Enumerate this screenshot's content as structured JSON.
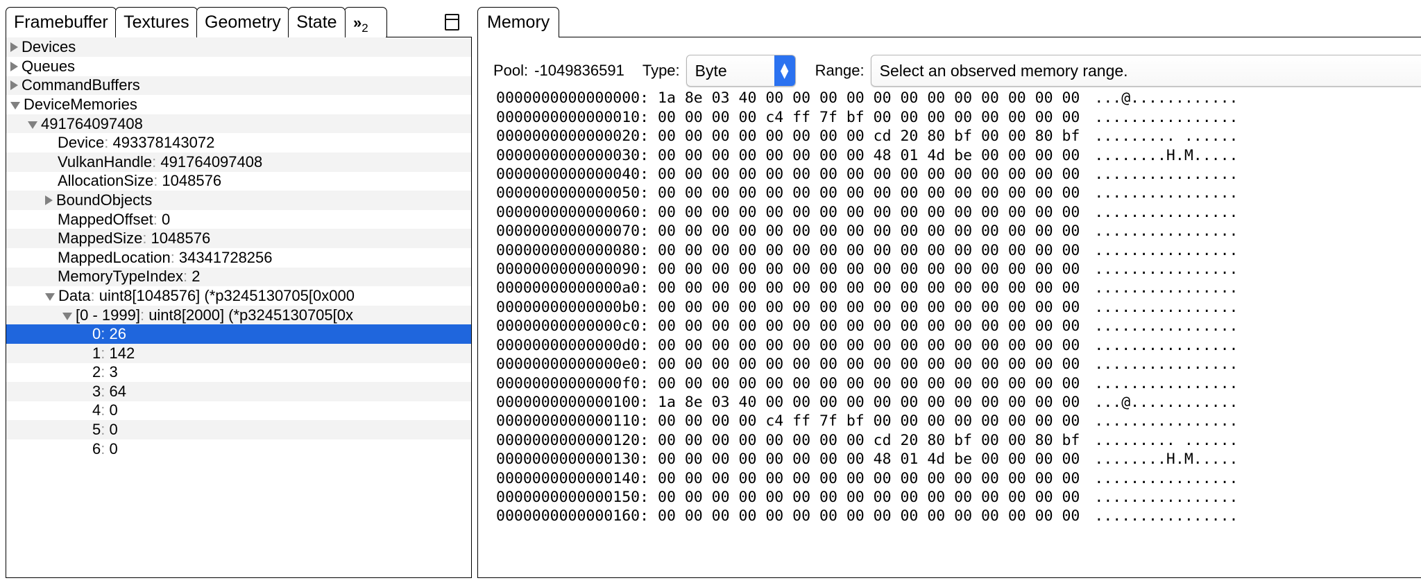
{
  "left_panel": {
    "tabs": [
      {
        "label": "Framebuffer",
        "active": false
      },
      {
        "label": "Textures",
        "active": false
      },
      {
        "label": "Geometry",
        "active": false
      },
      {
        "label": "State",
        "active": true
      }
    ],
    "overflow_tab": {
      "chevron": "»",
      "count": "2"
    },
    "dock_icon": "panel-dock-icon",
    "tree": [
      {
        "indent": 0,
        "arrow": "closed",
        "label": "Devices",
        "colon": "",
        "value": ""
      },
      {
        "indent": 0,
        "arrow": "closed",
        "label": "Queues",
        "colon": "",
        "value": ""
      },
      {
        "indent": 0,
        "arrow": "closed",
        "label": "CommandBuffers",
        "colon": "",
        "value": ""
      },
      {
        "indent": 0,
        "arrow": "open",
        "label": "DeviceMemories",
        "colon": "",
        "value": ""
      },
      {
        "indent": 1,
        "arrow": "open",
        "label": "491764097408",
        "colon": "",
        "value": ""
      },
      {
        "indent": 2,
        "arrow": "none",
        "label": "Device",
        "colon": ":",
        "value": "493378143072"
      },
      {
        "indent": 2,
        "arrow": "none",
        "label": "VulkanHandle",
        "colon": ":",
        "value": "491764097408"
      },
      {
        "indent": 2,
        "arrow": "none",
        "label": "AllocationSize",
        "colon": ":",
        "value": "1048576"
      },
      {
        "indent": 2,
        "arrow": "closed",
        "label": "BoundObjects",
        "colon": "",
        "value": ""
      },
      {
        "indent": 2,
        "arrow": "none",
        "label": "MappedOffset",
        "colon": ":",
        "value": "0"
      },
      {
        "indent": 2,
        "arrow": "none",
        "label": "MappedSize",
        "colon": ":",
        "value": "1048576"
      },
      {
        "indent": 2,
        "arrow": "none",
        "label": "MappedLocation",
        "colon": ":",
        "value": "34341728256"
      },
      {
        "indent": 2,
        "arrow": "none",
        "label": "MemoryTypeIndex",
        "colon": ":",
        "value": "2"
      },
      {
        "indent": 2,
        "arrow": "open",
        "label": "Data",
        "colon": ":",
        "value": "uint8[1048576] (*p3245130705[0x000"
      },
      {
        "indent": 3,
        "arrow": "open",
        "label": "[0 - 1999]",
        "colon": ":",
        "value": "uint8[2000] (*p3245130705[0x"
      },
      {
        "indent": 4,
        "arrow": "none",
        "label": "0",
        "colon": ":",
        "value": "26",
        "selected": true
      },
      {
        "indent": 4,
        "arrow": "none",
        "label": "1",
        "colon": ":",
        "value": "142"
      },
      {
        "indent": 4,
        "arrow": "none",
        "label": "2",
        "colon": ":",
        "value": "3"
      },
      {
        "indent": 4,
        "arrow": "none",
        "label": "3",
        "colon": ":",
        "value": "64"
      },
      {
        "indent": 4,
        "arrow": "none",
        "label": "4",
        "colon": ":",
        "value": "0"
      },
      {
        "indent": 4,
        "arrow": "none",
        "label": "5",
        "colon": ":",
        "value": "0"
      },
      {
        "indent": 4,
        "arrow": "none",
        "label": "6",
        "colon": ":",
        "value": "0"
      }
    ]
  },
  "right_panel": {
    "tab": {
      "label": "Memory"
    },
    "minimize_icon": "window-minimize-icon",
    "controls": {
      "pool_label": "Pool:",
      "pool_value": "-1049836591",
      "type_label": "Type:",
      "type_value": "Byte",
      "range_label": "Range:",
      "range_value": "Select an observed memory range."
    },
    "hexdump": [
      {
        "addr": "0000000000000000",
        "bytes": "1a 8e 03 40 00 00 00 00 00 00 00 00 00 00 00 00",
        "ascii": "...@............"
      },
      {
        "addr": "0000000000000010",
        "bytes": "00 00 00 00 c4 ff 7f bf 00 00 00 00 00 00 00 00",
        "ascii": "................"
      },
      {
        "addr": "0000000000000020",
        "bytes": "00 00 00 00 00 00 00 00 cd 20 80 bf 00 00 80 bf",
        "ascii": "......... ......"
      },
      {
        "addr": "0000000000000030",
        "bytes": "00 00 00 00 00 00 00 00 48 01 4d be 00 00 00 00",
        "ascii": "........H.M....."
      },
      {
        "addr": "0000000000000040",
        "bytes": "00 00 00 00 00 00 00 00 00 00 00 00 00 00 00 00",
        "ascii": "................"
      },
      {
        "addr": "0000000000000050",
        "bytes": "00 00 00 00 00 00 00 00 00 00 00 00 00 00 00 00",
        "ascii": "................"
      },
      {
        "addr": "0000000000000060",
        "bytes": "00 00 00 00 00 00 00 00 00 00 00 00 00 00 00 00",
        "ascii": "................"
      },
      {
        "addr": "0000000000000070",
        "bytes": "00 00 00 00 00 00 00 00 00 00 00 00 00 00 00 00",
        "ascii": "................"
      },
      {
        "addr": "0000000000000080",
        "bytes": "00 00 00 00 00 00 00 00 00 00 00 00 00 00 00 00",
        "ascii": "................"
      },
      {
        "addr": "0000000000000090",
        "bytes": "00 00 00 00 00 00 00 00 00 00 00 00 00 00 00 00",
        "ascii": "................"
      },
      {
        "addr": "00000000000000a0",
        "bytes": "00 00 00 00 00 00 00 00 00 00 00 00 00 00 00 00",
        "ascii": "................"
      },
      {
        "addr": "00000000000000b0",
        "bytes": "00 00 00 00 00 00 00 00 00 00 00 00 00 00 00 00",
        "ascii": "................"
      },
      {
        "addr": "00000000000000c0",
        "bytes": "00 00 00 00 00 00 00 00 00 00 00 00 00 00 00 00",
        "ascii": "................"
      },
      {
        "addr": "00000000000000d0",
        "bytes": "00 00 00 00 00 00 00 00 00 00 00 00 00 00 00 00",
        "ascii": "................"
      },
      {
        "addr": "00000000000000e0",
        "bytes": "00 00 00 00 00 00 00 00 00 00 00 00 00 00 00 00",
        "ascii": "................"
      },
      {
        "addr": "00000000000000f0",
        "bytes": "00 00 00 00 00 00 00 00 00 00 00 00 00 00 00 00",
        "ascii": "................"
      },
      {
        "addr": "0000000000000100",
        "bytes": "1a 8e 03 40 00 00 00 00 00 00 00 00 00 00 00 00",
        "ascii": "...@............"
      },
      {
        "addr": "0000000000000110",
        "bytes": "00 00 00 00 c4 ff 7f bf 00 00 00 00 00 00 00 00",
        "ascii": "................"
      },
      {
        "addr": "0000000000000120",
        "bytes": "00 00 00 00 00 00 00 00 cd 20 80 bf 00 00 80 bf",
        "ascii": "......... ......"
      },
      {
        "addr": "0000000000000130",
        "bytes": "00 00 00 00 00 00 00 00 48 01 4d be 00 00 00 00",
        "ascii": "........H.M....."
      },
      {
        "addr": "0000000000000140",
        "bytes": "00 00 00 00 00 00 00 00 00 00 00 00 00 00 00 00",
        "ascii": "................"
      },
      {
        "addr": "0000000000000150",
        "bytes": "00 00 00 00 00 00 00 00 00 00 00 00 00 00 00 00",
        "ascii": "................"
      },
      {
        "addr": "0000000000000160",
        "bytes": "00 00 00 00 00 00 00 00 00 00 00 00 00 00 00 00",
        "ascii": "................"
      }
    ]
  },
  "colors": {
    "selection": "#1f66dd",
    "combo_button": "#2b72f0",
    "row_alt": "#f3f3f3",
    "arrow": "#808080"
  }
}
